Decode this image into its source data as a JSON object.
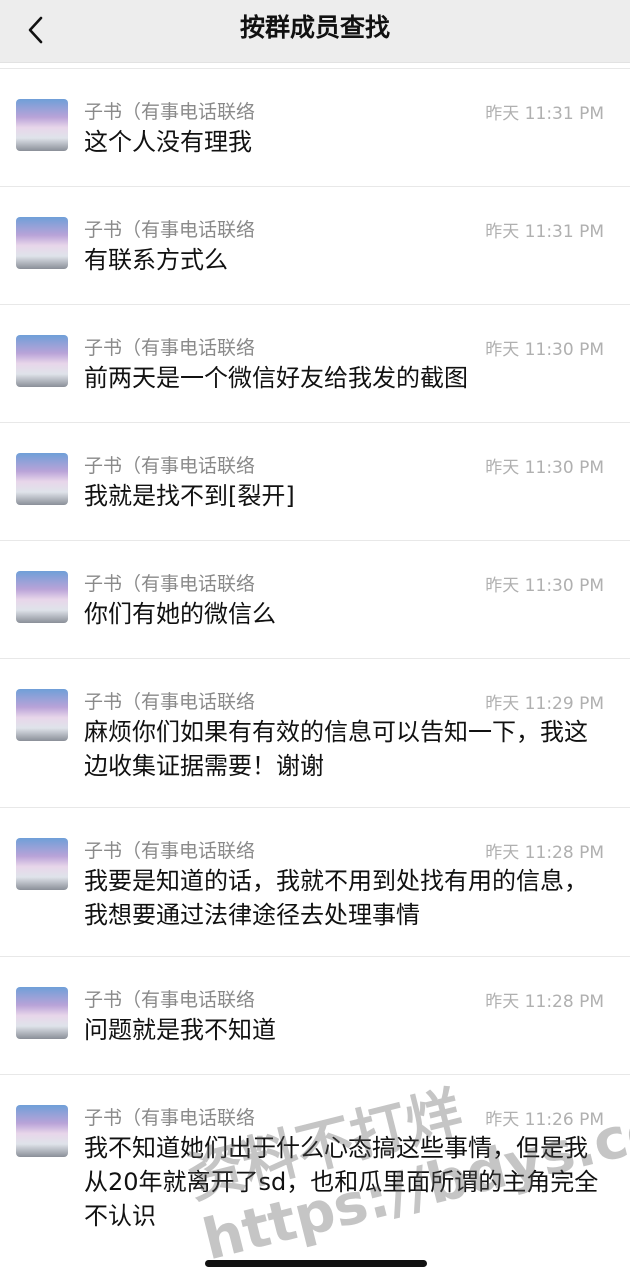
{
  "header": {
    "title": "按群成员查找",
    "back_icon": "chevron-left-icon"
  },
  "messages": [
    {
      "name": "子书（有事电话联络",
      "time": "昨天 11:31 PM",
      "text": "这个人没有理我"
    },
    {
      "name": "子书（有事电话联络",
      "time": "昨天 11:31 PM",
      "text": "有联系方式么"
    },
    {
      "name": "子书（有事电话联络",
      "time": "昨天 11:30 PM",
      "text": "前两天是一个微信好友给我发的截图"
    },
    {
      "name": "子书（有事电话联络",
      "time": "昨天 11:30 PM",
      "text": "我就是找不到[裂开]"
    },
    {
      "name": "子书（有事电话联络",
      "time": "昨天 11:30 PM",
      "text": "你们有她的微信么"
    },
    {
      "name": "子书（有事电话联络",
      "time": "昨天 11:29 PM",
      "text": "麻烦你们如果有有效的信息可以告知一下，我这边收集证据需要！谢谢"
    },
    {
      "name": "子书（有事电话联络",
      "time": "昨天 11:28 PM",
      "text": "我要是知道的话，我就不用到处找有用的信息，我想要通过法律途径去处理事情"
    },
    {
      "name": "子书（有事电话联络",
      "time": "昨天 11:28 PM",
      "text": "问题就是我不知道"
    },
    {
      "name": "子书（有事电话联络",
      "time": "昨天 11:26 PM",
      "text": "我不知道她们出于什么心态搞这些事情，但是我从20年就离开了sd，也和瓜里面所谓的主角完全不认识"
    }
  ],
  "watermark": {
    "line1": "资料不打烊",
    "line2": "https://bdys.co"
  }
}
